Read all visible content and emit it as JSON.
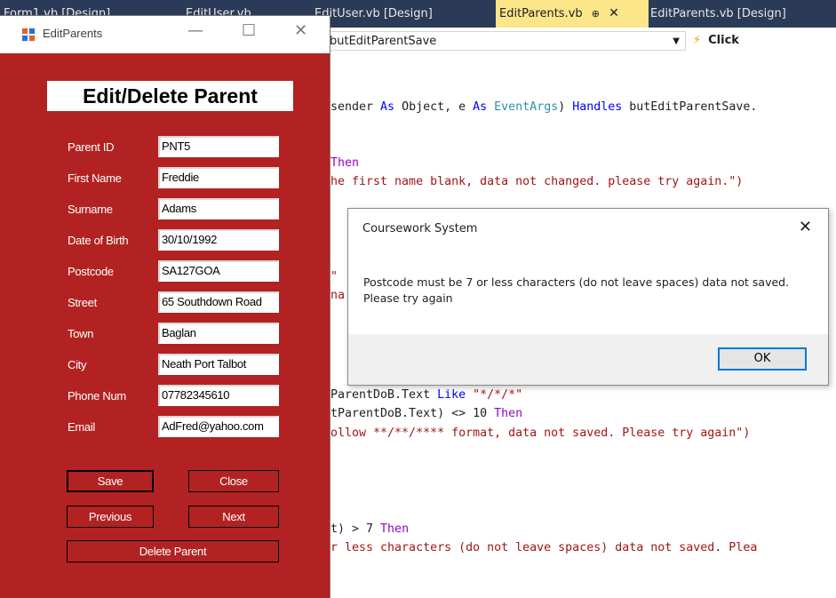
{
  "ide": {
    "tabs": [
      {
        "label": "Form1.vb [Design]"
      },
      {
        "label": "EditUser.vb"
      },
      {
        "label": "EditUser.vb [Design]"
      },
      {
        "label": "EditParents.vb",
        "pin": "⊕",
        "close": "✕"
      },
      {
        "label": "EditParents.vb [Design]"
      }
    ],
    "member_combo": "butEditParentSave",
    "event_combo": "Click",
    "code_lines": [
      {
        "parts": [
          {
            "t": "sender ",
            "c": ""
          },
          {
            "t": "As",
            "c": "kw"
          },
          {
            "t": " Object, e ",
            "c": ""
          },
          {
            "t": "As",
            "c": "kw"
          },
          {
            "t": " ",
            "c": ""
          },
          {
            "t": "EventArgs",
            "c": "typ"
          },
          {
            "t": ") ",
            "c": ""
          },
          {
            "t": "Handles",
            "c": "kw"
          },
          {
            "t": " butEditParentSave.",
            "c": ""
          }
        ]
      },
      {
        "parts": [
          {
            "t": "Then",
            "c": "kw2"
          }
        ]
      },
      {
        "parts": [
          {
            "t": "he first name blank, data not changed. please try again.\")",
            "c": "str"
          }
        ]
      },
      {
        "parts": [
          {
            "t": "\"",
            "c": "str"
          }
        ]
      },
      {
        "parts": [
          {
            "t": "na",
            "c": "str"
          }
        ]
      },
      {
        "parts": [
          {
            "t": "ParentDoB.Text ",
            "c": ""
          },
          {
            "t": "Like",
            "c": "kw"
          },
          {
            "t": " ",
            "c": ""
          },
          {
            "t": "\"*/*/*\"",
            "c": "str"
          }
        ]
      },
      {
        "parts": [
          {
            "t": "tParentDoB.Text) <> 10 ",
            "c": ""
          },
          {
            "t": "Then",
            "c": "kw2"
          }
        ]
      },
      {
        "parts": [
          {
            "t": "ollow **/**/**** format, data not saved. Please try again\")",
            "c": "str"
          }
        ]
      },
      {
        "parts": [
          {
            "t": "t) > 7 ",
            "c": ""
          },
          {
            "t": "Then",
            "c": "kw2"
          }
        ]
      },
      {
        "parts": [
          {
            "t": "r less characters (do not leave spaces) data not saved. Plea",
            "c": "str"
          }
        ]
      }
    ]
  },
  "form": {
    "title": "EditParents",
    "minimize": "—",
    "maximize": "☐",
    "close": "✕",
    "heading": "Edit/Delete Parent",
    "fields": [
      {
        "label": "Parent ID",
        "value": "PNT5"
      },
      {
        "label": "First Name",
        "value": "Freddie"
      },
      {
        "label": "Surname",
        "value": "Adams"
      },
      {
        "label": "Date of Birth",
        "value": "30/10/1992"
      },
      {
        "label": "Postcode",
        "value": "SA127GOA"
      },
      {
        "label": "Street",
        "value": "65 Southdown Road"
      },
      {
        "label": "Town",
        "value": "Baglan"
      },
      {
        "label": "City",
        "value": "Neath Port Talbot"
      },
      {
        "label": "Phone Num",
        "value": "07782345610"
      },
      {
        "label": "Email",
        "value": "AdFred@yahoo.com"
      }
    ],
    "buttons": {
      "save": "Save",
      "close": "Close",
      "previous": "Previous",
      "next": "Next",
      "delete": "Delete Parent"
    },
    "background_color": "#b22222"
  },
  "messagebox": {
    "title": "Coursework System",
    "close": "✕",
    "message": "Postcode must be 7 or less characters (do not leave spaces) data not saved. Please try again",
    "ok": "OK"
  }
}
